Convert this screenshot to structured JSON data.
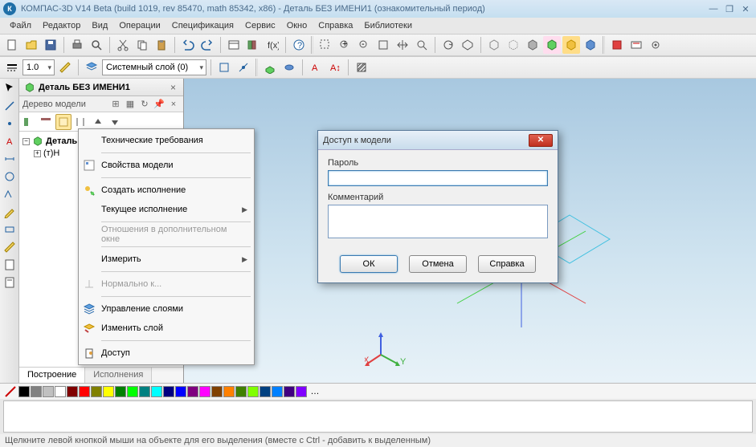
{
  "title": "КОМПАС-3D V14 Beta (build 1019, rev 85470, math 85342, x86) - Деталь БЕЗ ИМЕНИ1 (ознакомительный период)",
  "menus": [
    "Файл",
    "Редактор",
    "Вид",
    "Операции",
    "Спецификация",
    "Сервис",
    "Окно",
    "Справка",
    "Библиотеки"
  ],
  "toolbar2": {
    "scale": "1.0",
    "layer": "Системный слой (0)"
  },
  "doc_tab": "Деталь БЕЗ ИМЕНИ1",
  "tree": {
    "header": "Дерево модели",
    "root": "Деталь",
    "child": "(т)Н",
    "tabs": [
      "Построение",
      "Исполнения"
    ]
  },
  "context_menu": {
    "items": [
      {
        "label": "Технические требования",
        "icon": "",
        "enabled": true
      },
      {
        "label": "Свойства модели",
        "icon": "props",
        "enabled": true
      },
      {
        "label": "Создать исполнение",
        "icon": "create",
        "enabled": true
      },
      {
        "label": "Текущее исполнение",
        "icon": "",
        "enabled": true,
        "submenu": true
      },
      {
        "label": "Отношения в дополнительном окне",
        "icon": "",
        "enabled": false
      },
      {
        "label": "Измерить",
        "icon": "",
        "enabled": true,
        "submenu": true
      },
      {
        "label": "Нормально к...",
        "icon": "normal",
        "enabled": false
      },
      {
        "label": "Управление слоями",
        "icon": "layers",
        "enabled": true
      },
      {
        "label": "Изменить слой",
        "icon": "change-layer",
        "enabled": true
      },
      {
        "label": "Доступ",
        "icon": "access",
        "enabled": true
      }
    ]
  },
  "dialog": {
    "title": "Доступ к модели",
    "password_label": "Пароль",
    "password_value": "",
    "comment_label": "Комментарий",
    "comment_value": "",
    "ok": "ОК",
    "cancel": "Отмена",
    "help": "Справка"
  },
  "axes": {
    "x": "X",
    "y": "Y"
  },
  "status": "Щелкните левой кнопкой мыши на объекте для его выделения (вместе с Ctrl - добавить к выделенным)",
  "colors": [
    "#000000",
    "#808080",
    "#c0c0c0",
    "#ffffff",
    "#800000",
    "#ff0000",
    "#808000",
    "#ffff00",
    "#008000",
    "#00ff00",
    "#008080",
    "#00ffff",
    "#000080",
    "#0000ff",
    "#800080",
    "#ff00ff",
    "#804000",
    "#ff8000",
    "#408000",
    "#80ff00",
    "#004080",
    "#0080ff",
    "#400080",
    "#8000ff"
  ]
}
